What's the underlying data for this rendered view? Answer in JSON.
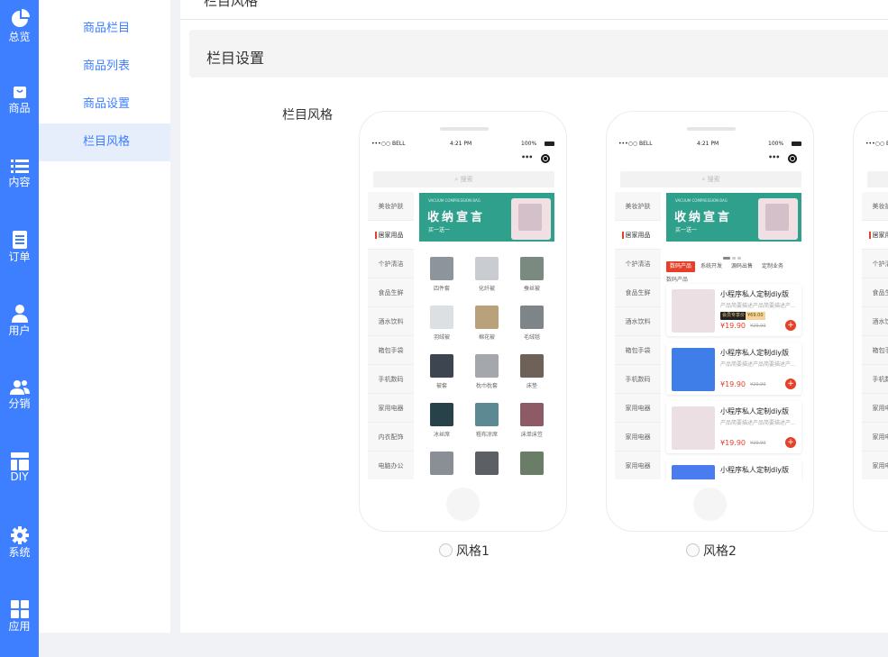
{
  "rail": {
    "items": [
      {
        "label": "总览",
        "icon": "pie-chart-icon"
      },
      {
        "label": "商品",
        "icon": "shopping-bag-icon"
      },
      {
        "label": "内容",
        "icon": "list-icon"
      },
      {
        "label": "订单",
        "icon": "order-doc-icon"
      },
      {
        "label": "用户",
        "icon": "user-icon"
      },
      {
        "label": "分销",
        "icon": "users-icon"
      },
      {
        "label": "DIY",
        "icon": "layout-icon"
      },
      {
        "label": "系统",
        "icon": "gear-icon"
      },
      {
        "label": "应用",
        "icon": "apps-grid-icon"
      }
    ]
  },
  "subnav": {
    "items": [
      {
        "label": "商品栏目"
      },
      {
        "label": "商品列表"
      },
      {
        "label": "商品设置"
      },
      {
        "label": "栏目风格"
      }
    ]
  },
  "page": {
    "top_title": "栏目风格",
    "section_title": "栏目设置",
    "field_label": "栏目风格"
  },
  "phone": {
    "carrier": "•••○○ BELL",
    "time": "4:21 PM",
    "battery": "100%",
    "search_placeholder": "搜索",
    "banner_small": "VACUUM COMPRESSION BAG",
    "banner_big": "收纳宣言",
    "banner_sub": "买一送一",
    "categories": [
      "美妆护肤",
      "居家用品",
      "个护清洁",
      "食品生鲜",
      "酒水饮料",
      "箱包手袋",
      "手机数码",
      "家用电器",
      "内衣配饰",
      "电脑办公"
    ],
    "categories2": [
      "美妆护肤",
      "居家用品",
      "个护清洁",
      "食品生鲜",
      "酒水饮料",
      "箱包手袋",
      "手机数码",
      "家用电器",
      "家用电器",
      "家用电器"
    ],
    "grid": [
      "四件套",
      "化纤被",
      "蚕丝被",
      "羽绒被",
      "棉花被",
      "毛绒毯",
      "被套",
      "枕巾枕套",
      "床垫",
      "冰丝席",
      "粗布凉席",
      "床单床笠",
      "",
      "",
      ""
    ],
    "tabs": [
      "数码产品",
      "系统开发",
      "源码出售",
      "定制业务"
    ],
    "list_title": "数码产品",
    "product_title": "小程序私人定制diy版",
    "product_desc": "产品简要描述产品简要描述产...",
    "vip_label": "会员专享价",
    "vip_price": "¥69.00",
    "price": "¥19.90",
    "old_price": "¥29.90"
  },
  "styles": [
    {
      "label": "风格1"
    },
    {
      "label": "风格2"
    }
  ],
  "colors": {
    "accent": "#3d7fff",
    "red": "#e6402a",
    "banner": "#2fa08c"
  }
}
